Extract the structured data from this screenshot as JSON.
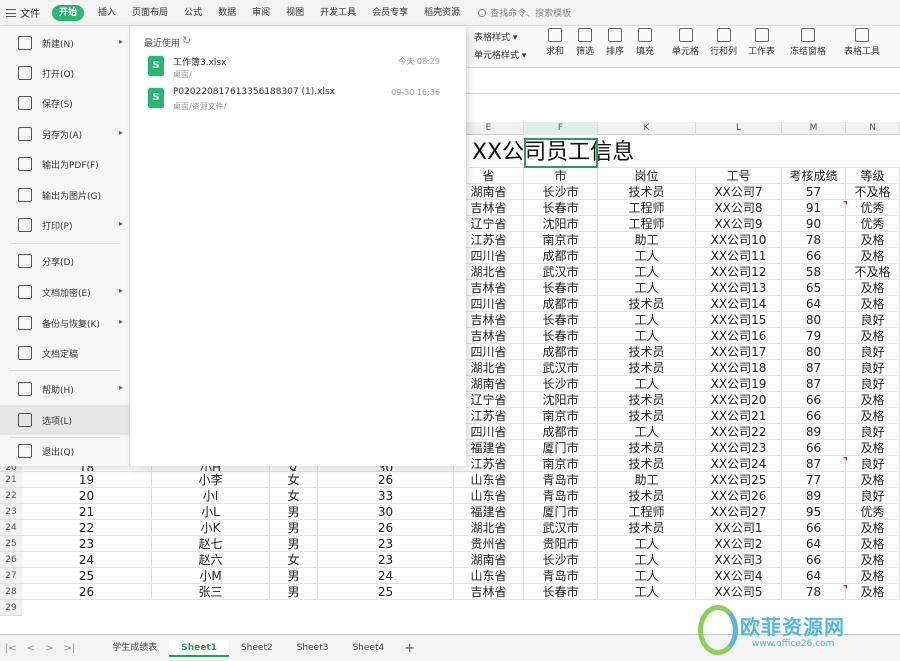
{
  "menubar": {
    "file_label": "文件",
    "tabs": [
      "开始",
      "插入",
      "页面布局",
      "公式",
      "数据",
      "审阅",
      "视图",
      "开发工具",
      "会员专享",
      "稻壳资源"
    ],
    "search_placeholder": "查找命令、搜索模板"
  },
  "ribbon": {
    "table_style": "表格样式",
    "cell_style": "单元格样式",
    "buttons": [
      "求和",
      "筛选",
      "排序",
      "填充",
      "单元格",
      "行和列",
      "工作表",
      "冻结窗格",
      "表格工具"
    ]
  },
  "file_menu": {
    "items": [
      "新建(N)",
      "打开(O)",
      "保存(S)",
      "另存为(A)",
      "输出为PDF(F)",
      "输出为图片(G)",
      "打印(P)",
      "分享(D)",
      "文档加密(E)",
      "备份与恢复(K)",
      "文档定稿",
      "帮助(H)",
      "选项(L)",
      "退出(Q)"
    ]
  },
  "recent": {
    "title": "最近使用",
    "files": [
      {
        "name": "工作簿3.xlsx",
        "path": "桌面/",
        "date": "今天  08:29"
      },
      {
        "name": "P020220817613356188307 (1).xlsx",
        "path": "桌面/资源文件/",
        "date": "09-30  16:36"
      }
    ]
  },
  "sheet": {
    "title": "XX公司员工信息",
    "right_headers": [
      "省",
      "市",
      "岗位",
      "工号",
      "考核成绩",
      "等级"
    ],
    "right_col_letters": [
      "E",
      "F",
      "K",
      "L",
      "M",
      "N"
    ],
    "right_rows": [
      [
        "湖南省",
        "长沙市",
        "技术员",
        "XX公司7",
        "57",
        "不及格"
      ],
      [
        "吉林省",
        "长春市",
        "工程师",
        "XX公司8",
        "91",
        "优秀"
      ],
      [
        "辽宁省",
        "沈阳市",
        "工程师",
        "XX公司9",
        "90",
        "优秀"
      ],
      [
        "江苏省",
        "南京市",
        "助工",
        "XX公司10",
        "78",
        "及格"
      ],
      [
        "四川省",
        "成都市",
        "工人",
        "XX公司11",
        "66",
        "及格"
      ],
      [
        "湖北省",
        "武汉市",
        "工人",
        "XX公司12",
        "58",
        "不及格"
      ],
      [
        "吉林省",
        "长春市",
        "工人",
        "XX公司13",
        "65",
        "及格"
      ],
      [
        "四川省",
        "成都市",
        "技术员",
        "XX公司14",
        "64",
        "及格"
      ],
      [
        "吉林省",
        "长春市",
        "工人",
        "XX公司15",
        "80",
        "良好"
      ],
      [
        "吉林省",
        "长春市",
        "工人",
        "XX公司16",
        "79",
        "及格"
      ],
      [
        "四川省",
        "成都市",
        "技术员",
        "XX公司17",
        "80",
        "良好"
      ],
      [
        "湖北省",
        "武汉市",
        "技术员",
        "XX公司18",
        "87",
        "良好"
      ],
      [
        "湖南省",
        "长沙市",
        "工人",
        "XX公司19",
        "87",
        "良好"
      ],
      [
        "辽宁省",
        "沈阳市",
        "技术员",
        "XX公司20",
        "66",
        "及格"
      ],
      [
        "江苏省",
        "南京市",
        "技术员",
        "XX公司21",
        "66",
        "及格"
      ],
      [
        "四川省",
        "成都市",
        "工人",
        "XX公司22",
        "89",
        "良好"
      ],
      [
        "福建省",
        "厦门市",
        "技术员",
        "XX公司23",
        "66",
        "及格"
      ],
      [
        "江苏省",
        "南京市",
        "技术员",
        "XX公司24",
        "87",
        "良好"
      ],
      [
        "山东省",
        "青岛市",
        "助工",
        "XX公司25",
        "77",
        "及格"
      ],
      [
        "山东省",
        "青岛市",
        "技术员",
        "XX公司26",
        "89",
        "良好"
      ],
      [
        "福建省",
        "厦门市",
        "工程师",
        "XX公司27",
        "95",
        "优秀"
      ],
      [
        "湖北省",
        "武汉市",
        "技术员",
        "XX公司1",
        "66",
        "及格"
      ],
      [
        "贵州省",
        "贵阳市",
        "工人",
        "XX公司2",
        "64",
        "及格"
      ],
      [
        "湖南省",
        "长沙市",
        "工人",
        "XX公司3",
        "66",
        "及格"
      ],
      [
        "山东省",
        "青岛市",
        "工人",
        "XX公司4",
        "64",
        "及格"
      ],
      [
        "吉林省",
        "长春市",
        "工人",
        "XX公司5",
        "78",
        "及格"
      ]
    ],
    "left_rows": [
      [
        "21",
        "19",
        "小李",
        "女",
        "26"
      ],
      [
        "22",
        "20",
        "小I",
        "女",
        "33"
      ],
      [
        "23",
        "21",
        "小L",
        "男",
        "30"
      ],
      [
        "24",
        "22",
        "小K",
        "男",
        "26"
      ],
      [
        "25",
        "23",
        "赵七",
        "男",
        "23"
      ],
      [
        "26",
        "24",
        "赵六",
        "女",
        "23"
      ],
      [
        "27",
        "25",
        "小M",
        "男",
        "24"
      ],
      [
        "28",
        "26",
        "张三",
        "男",
        "25"
      ]
    ],
    "partial_row": [
      "20",
      "18",
      "小H",
      "女",
      "30"
    ],
    "row_29": "29"
  },
  "sheet_tabs": {
    "nav": [
      "|<",
      "<",
      ">",
      ">|"
    ],
    "tabs": [
      "学生成绩表",
      "Sheet1",
      "Sheet2",
      "Sheet3",
      "Sheet4"
    ],
    "active": "Sheet1",
    "add": "+"
  },
  "watermark": {
    "text": "欧菲资源网",
    "url": "www.office26.com"
  },
  "colors": {
    "accent": "#2bb673",
    "selection": "#2b9b62"
  }
}
